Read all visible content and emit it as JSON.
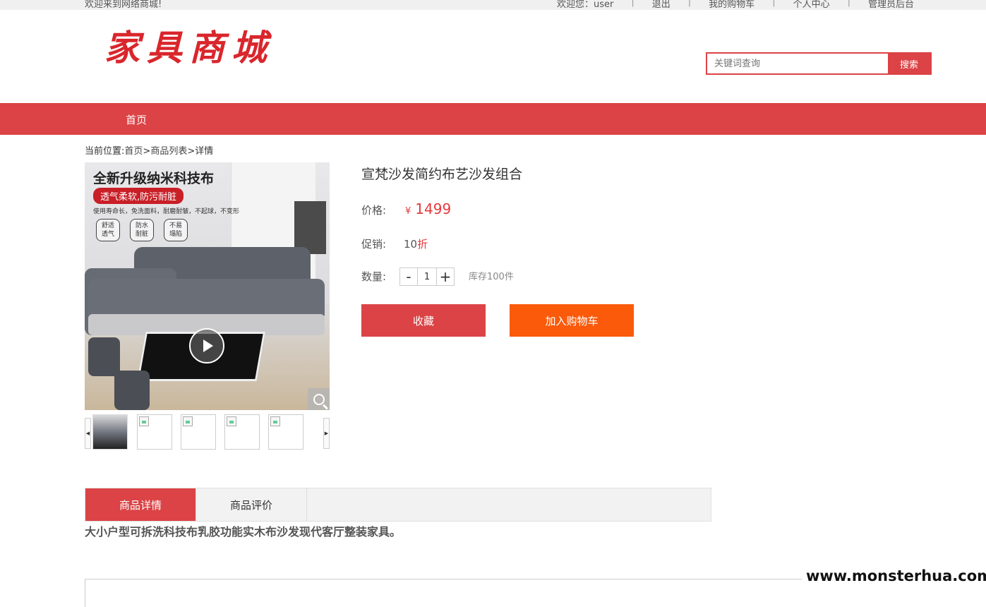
{
  "topbar": {
    "welcome": "欢迎来到网络商城!",
    "links": [
      "欢迎您：user",
      "退出",
      "我的购物车",
      "个人中心",
      "管理员后台"
    ]
  },
  "header": {
    "logo": "家具商城",
    "search_placeholder": "关键词查询",
    "search_button": "搜索"
  },
  "nav": {
    "home": "首页"
  },
  "breadcrumb": {
    "prefix": "当前位置:",
    "home": "首页",
    "sep1": ">",
    "list": "商品列表",
    "sep2": ">",
    "current": "详情"
  },
  "gallery": {
    "headline": "全新升级纳米科技布",
    "pill": "透气柔软,防污耐脏",
    "subline": "使用寿命长，免洗面料，耐磨耐皱，不起球，不变形",
    "badges": [
      "舒适\n透气",
      "防水\n耐脏",
      "不易\n塌陷"
    ],
    "thumb_count": 5
  },
  "product": {
    "title": "宣梵沙发简约布艺沙发组合",
    "price_label": "价格:",
    "currency": "¥",
    "price": "1499",
    "promo_label": "促销:",
    "promo_value": "10",
    "promo_unit": "折",
    "qty_label": "数量:",
    "qty_minus": "-",
    "qty_value": "1",
    "qty_plus": "+",
    "stock": "库存100件",
    "fav_button": "收藏",
    "cart_button": "加入购物车"
  },
  "tabs": {
    "detail": "商品详情",
    "reviews": "商品评价"
  },
  "description": "大小户型可拆洗科技布乳胶功能实木布沙发现代客厅整装家具。",
  "watermark": "www.monsterhua.com",
  "colors": {
    "accent": "#db4346",
    "cart": "#fa5a0a",
    "price": "#e4393c"
  }
}
